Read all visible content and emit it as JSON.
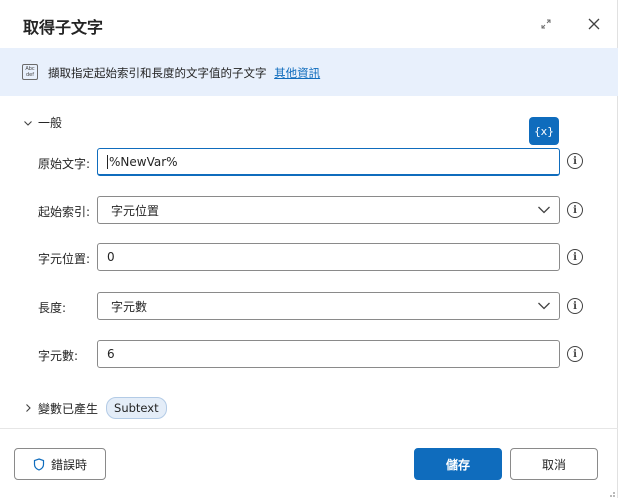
{
  "dialog": {
    "title": "取得子文字",
    "icons": {
      "expand": "expand-icon",
      "close": "close-icon"
    }
  },
  "info": {
    "icon": "abc-def-icon",
    "icon_text": "Abc def",
    "description": "擷取指定起始索引和長度的文字值的子文字",
    "link": "其他資訊"
  },
  "general": {
    "label": "一般",
    "var_button": "{x}"
  },
  "fields": {
    "original_text": {
      "label": "原始文字:",
      "value": "%NewVar%"
    },
    "start_index": {
      "label": "起始索引:",
      "value": "字元位置"
    },
    "char_position": {
      "label": "字元位置:",
      "value": "0"
    },
    "length": {
      "label": "長度:",
      "value": "字元數"
    },
    "char_count": {
      "label": "字元數:",
      "value": "6"
    }
  },
  "variables": {
    "label": "變數已產生",
    "pill": "Subtext"
  },
  "footer": {
    "on_error": "錯誤時",
    "save": "儲存",
    "cancel": "取消"
  },
  "colors": {
    "accent": "#0f6cbd",
    "info_bg": "#e8f0fc"
  }
}
